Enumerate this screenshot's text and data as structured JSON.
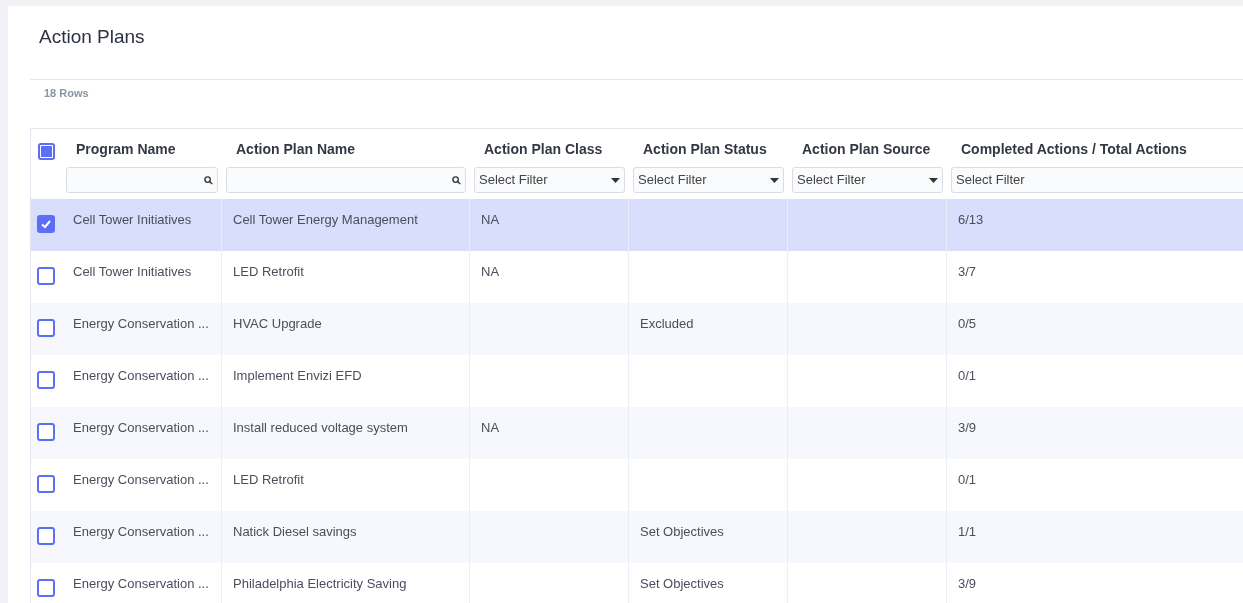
{
  "title": "Action Plans",
  "row_count": "18 Rows",
  "table": {
    "select_all": {
      "indeterminate": true
    },
    "columns": [
      {
        "label": "Program Name",
        "filter": {
          "kind": "search"
        }
      },
      {
        "label": "Action Plan Name",
        "filter": {
          "kind": "search"
        }
      },
      {
        "label": "Action Plan Class",
        "filter": {
          "kind": "select",
          "placeholder": "Select Filter"
        }
      },
      {
        "label": "Action Plan Status",
        "filter": {
          "kind": "select",
          "placeholder": "Select Filter"
        }
      },
      {
        "label": "Action Plan Source",
        "filter": {
          "kind": "select",
          "placeholder": "Select Filter"
        }
      },
      {
        "label": "Completed Actions / Total Actions",
        "filter": {
          "kind": "select",
          "placeholder": "Select Filter"
        }
      }
    ],
    "rows": [
      {
        "selected": true,
        "cells": [
          "Cell Tower Initiatives",
          "Cell Tower Energy Management",
          "NA",
          "",
          "",
          "6/13"
        ]
      },
      {
        "selected": false,
        "cells": [
          "Cell Tower Initiatives",
          "LED Retrofit",
          "NA",
          "",
          "",
          "3/7"
        ]
      },
      {
        "selected": false,
        "cells": [
          "Energy Conservation ...",
          "HVAC Upgrade",
          "",
          "Excluded",
          "",
          "0/5"
        ]
      },
      {
        "selected": false,
        "cells": [
          "Energy Conservation ...",
          "Implement Envizi EFD",
          "",
          "",
          "",
          "0/1"
        ]
      },
      {
        "selected": false,
        "cells": [
          "Energy Conservation ...",
          "Install reduced voltage system",
          "NA",
          "",
          "",
          "3/9"
        ]
      },
      {
        "selected": false,
        "cells": [
          "Energy Conservation ...",
          "LED Retrofit",
          "",
          "",
          "",
          "0/1"
        ]
      },
      {
        "selected": false,
        "cells": [
          "Energy Conservation ...",
          "Natick Diesel savings",
          "",
          "Set Objectives",
          "",
          "1/1"
        ]
      },
      {
        "selected": false,
        "cells": [
          "Energy Conservation ...",
          "Philadelphia Electricity Saving",
          "",
          "Set Objectives",
          "",
          "3/9"
        ]
      }
    ]
  }
}
